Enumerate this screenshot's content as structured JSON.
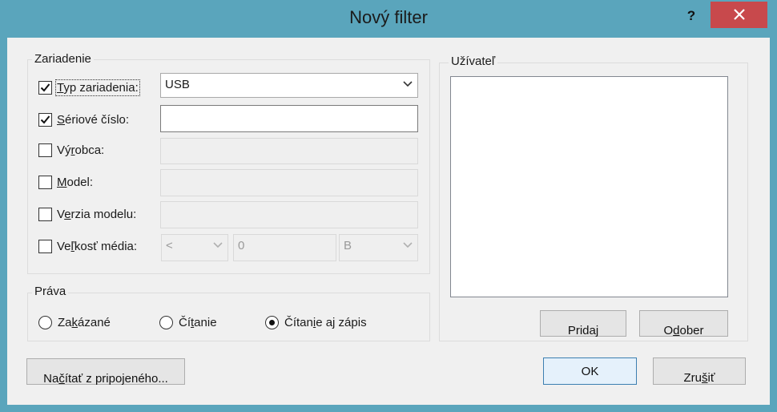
{
  "window": {
    "title": "Nový filter",
    "help": "?"
  },
  "device_group": {
    "title": "Zariadenie",
    "rows": [
      {
        "label_pre": "",
        "label_u": "T",
        "label_post": "yp zariadenia:",
        "checked": true
      },
      {
        "label_pre": "",
        "label_u": "S",
        "label_post": "ériové číslo:",
        "checked": true
      },
      {
        "label_pre": "Vý",
        "label_u": "r",
        "label_post": "obca:",
        "checked": false
      },
      {
        "label_pre": "",
        "label_u": "M",
        "label_post": "odel:",
        "checked": false
      },
      {
        "label_pre": "V",
        "label_u": "e",
        "label_post": "rzia modelu:",
        "checked": false
      },
      {
        "label_pre": "Ve",
        "label_u": "ľ",
        "label_post": "kosť média:",
        "checked": false
      }
    ],
    "device_type_value": "USB",
    "serial_value": "",
    "size_operator": "<",
    "size_value": "0",
    "size_unit": "B"
  },
  "rights_group": {
    "title": "Práva",
    "options": [
      {
        "pre": "Za",
        "u": "k",
        "post": "ázané",
        "selected": false
      },
      {
        "pre": "Čí",
        "u": "t",
        "post": "anie",
        "selected": false
      },
      {
        "pre": "Čítan",
        "u": "i",
        "post": "e aj zápis",
        "selected": true
      }
    ]
  },
  "user_group": {
    "title": "Užívateľ",
    "add_pre": "Prida",
    "add_u": "j",
    "add_post": "",
    "remove_pre": "O",
    "remove_u": "d",
    "remove_post": "ober"
  },
  "footer": {
    "load_pre": "Na",
    "load_u": "č",
    "load_post": "ítať z pripojeného...",
    "ok": "OK",
    "cancel_pre": "Zru",
    "cancel_u": "š",
    "cancel_post": "iť"
  },
  "colors": {
    "titlebar": "#5aa5bc",
    "close": "#c8494c",
    "dialog_bg": "#f0f0f0"
  }
}
